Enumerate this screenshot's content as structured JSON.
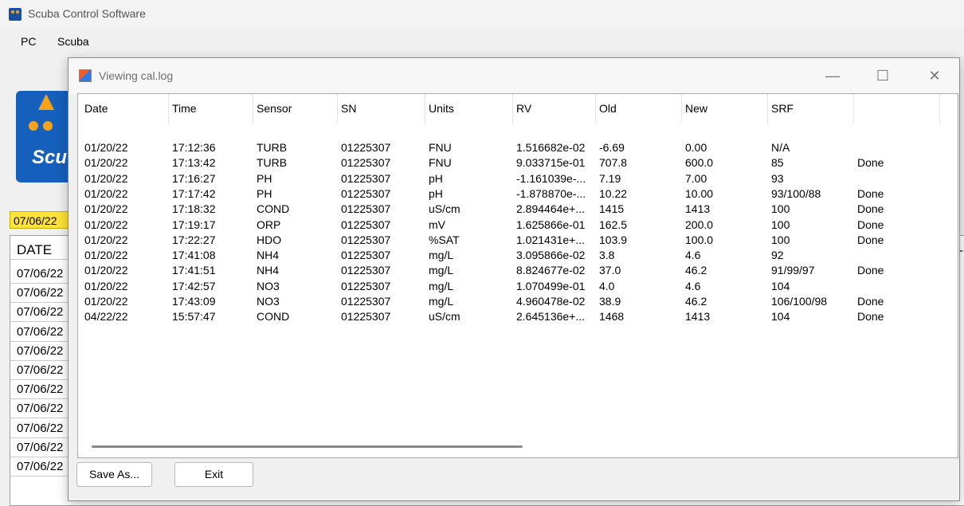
{
  "app": {
    "title": "Scuba Control Software",
    "menu": [
      "PC",
      "Scuba"
    ]
  },
  "background": {
    "logo_text": "Scu",
    "date_field": "07/06/22",
    "table_header": "DATE",
    "right_mark": "-|",
    "rows": [
      "07/06/22",
      "07/06/22",
      "07/06/22",
      "07/06/22",
      "07/06/22",
      "07/06/22",
      "07/06/22",
      "07/06/22",
      "07/06/22",
      "07/06/22",
      "07/06/22"
    ]
  },
  "dialog": {
    "title": "Viewing cal.log",
    "buttons": {
      "minimize": "—",
      "maximize": "☐",
      "close": "✕"
    },
    "columns": [
      "Date",
      "Time",
      "Sensor",
      "SN",
      "Units",
      "RV",
      "Old",
      "New",
      "SRF",
      ""
    ],
    "rows": [
      [
        "01/20/22",
        "17:12:36",
        "TURB",
        "01225307",
        "FNU",
        "1.516682e-02",
        "-6.69",
        "0.00",
        "N/A",
        ""
      ],
      [
        "01/20/22",
        "17:13:42",
        "TURB",
        "01225307",
        "FNU",
        "9.033715e-01",
        "707.8",
        "600.0",
        "85",
        "Done"
      ],
      [
        "01/20/22",
        "17:16:27",
        "PH",
        "01225307",
        "pH",
        "-1.161039e-...",
        "7.19",
        "7.00",
        "93",
        ""
      ],
      [
        "01/20/22",
        "17:17:42",
        "PH",
        "01225307",
        "pH",
        "-1.878870e-...",
        "10.22",
        "10.00",
        "93/100/88",
        "Done"
      ],
      [
        "01/20/22",
        "17:18:32",
        "COND",
        "01225307",
        "uS/cm",
        "2.894464e+...",
        "1415",
        "1413",
        "100",
        "Done"
      ],
      [
        "01/20/22",
        "17:19:17",
        "ORP",
        "01225307",
        "mV",
        "1.625866e-01",
        "162.5",
        "200.0",
        "100",
        "Done"
      ],
      [
        "01/20/22",
        "17:22:27",
        "HDO",
        "01225307",
        "%SAT",
        "1.021431e+...",
        "103.9",
        "100.0",
        "100",
        "Done"
      ],
      [
        "01/20/22",
        "17:41:08",
        "NH4",
        "01225307",
        "mg/L",
        "3.095866e-02",
        "3.8",
        "4.6",
        "92",
        ""
      ],
      [
        "01/20/22",
        "17:41:51",
        "NH4",
        "01225307",
        "mg/L",
        "8.824677e-02",
        "37.0",
        "46.2",
        "91/99/97",
        "Done"
      ],
      [
        "01/20/22",
        "17:42:57",
        "NO3",
        "01225307",
        "mg/L",
        "1.070499e-01",
        "4.0",
        "4.6",
        "104",
        ""
      ],
      [
        "01/20/22",
        "17:43:09",
        "NO3",
        "01225307",
        "mg/L",
        "4.960478e-02",
        "38.9",
        "46.2",
        "106/100/98",
        "Done"
      ],
      [
        "04/22/22",
        "15:57:47",
        "COND",
        "01225307",
        "uS/cm",
        "2.645136e+...",
        "1468",
        "1413",
        "104",
        "Done"
      ]
    ],
    "save_as_label": "Save As...",
    "exit_label": "Exit"
  }
}
